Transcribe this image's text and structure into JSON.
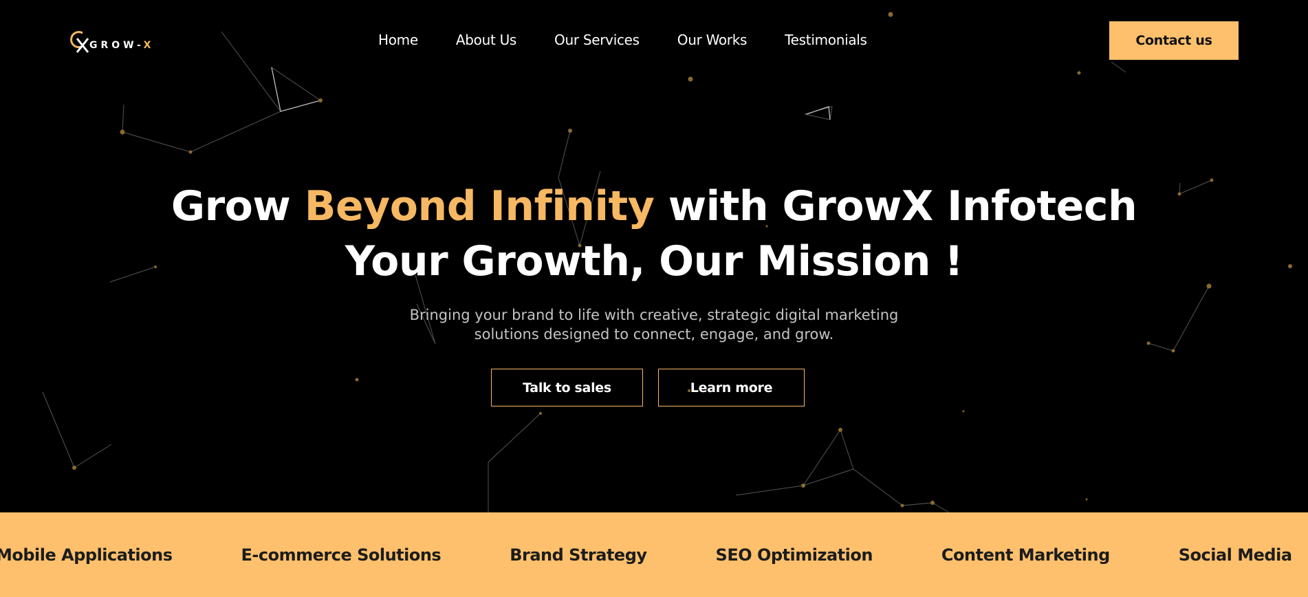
{
  "brand": {
    "name_prefix": "GROW-",
    "name_suffix": "X",
    "accent_color": "#f6b863",
    "button_color": "#fec06c",
    "background_color": "#000000"
  },
  "nav": {
    "items": [
      {
        "label": "Home"
      },
      {
        "label": "About Us"
      },
      {
        "label": "Our Services"
      },
      {
        "label": "Our Works"
      },
      {
        "label": "Testimonials"
      }
    ],
    "contact_label": "Contact us"
  },
  "hero": {
    "line1_pre": "Grow ",
    "line1_accent": "Beyond Infinity",
    "line1_post": " with GrowX Infotech",
    "line2": "Your Growth, Our Mission !",
    "subtitle": "Bringing your brand to life with creative, strategic digital marketing solutions designed to connect, engage, and grow.",
    "primary_cta": "Talk to sales",
    "secondary_cta": "Learn more"
  },
  "ticker": {
    "items": [
      "Mobile Applications",
      "E-commerce Solutions",
      "Brand Strategy",
      "SEO Optimization",
      "Content Marketing",
      "Social Media"
    ]
  }
}
